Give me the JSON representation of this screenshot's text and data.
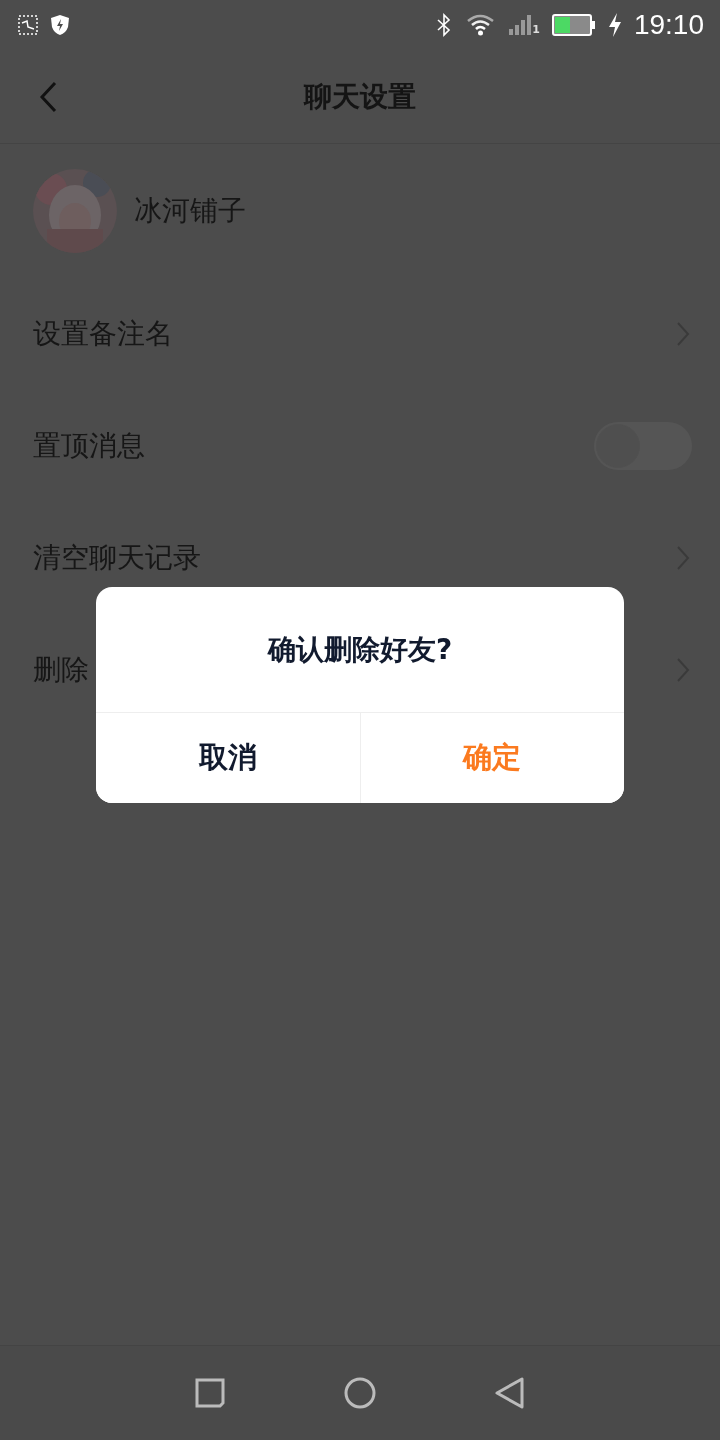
{
  "status_bar": {
    "time": "19:10",
    "sim_number": "1"
  },
  "header": {
    "title": "聊天设置"
  },
  "profile": {
    "name": "冰河铺子"
  },
  "settings": [
    {
      "kind": "link",
      "label": "设置备注名"
    },
    {
      "kind": "toggle",
      "label": "置顶消息",
      "on": false
    },
    {
      "kind": "link",
      "label": "清空聊天记录"
    },
    {
      "kind": "link",
      "label": "删除"
    }
  ],
  "dialog": {
    "title": "确认删除好友?",
    "buttons": [
      {
        "label": "取消",
        "kind": "cancel"
      },
      {
        "label": "确定",
        "kind": "confirm"
      }
    ]
  }
}
